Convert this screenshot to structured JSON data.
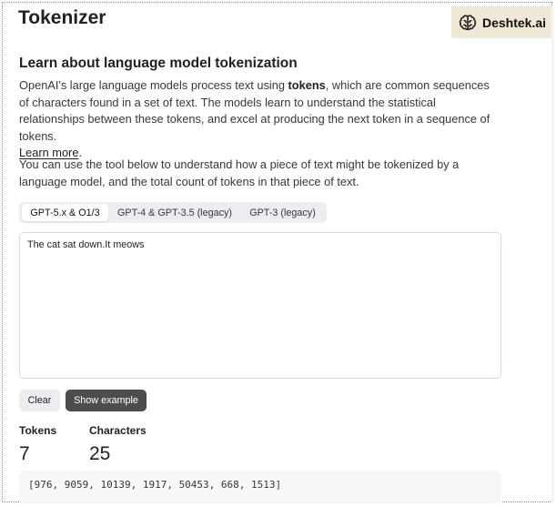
{
  "page": {
    "title": "Tokenizer"
  },
  "brand": {
    "icon": "brain-icon",
    "name": "Deshtek.ai",
    "background_color": "#f1e7d7"
  },
  "intro": {
    "heading": "Learn about language model tokenization",
    "p1_before": "OpenAI's large language models process text using ",
    "p1_bold": "tokens",
    "p1_after": ", which are common sequences of characters found in a set of text. The models learn to understand the statistical relationships between these tokens, and excel at producing the next token in a sequence of tokens.",
    "learn_more_label": "Learn more",
    "learn_more_suffix": ".",
    "p2": "You can use the tool below to understand how a piece of text might be tokenized by a language model, and the total count of tokens in that piece of text."
  },
  "tabs": [
    {
      "label": "GPT-5.x & O1/3",
      "active": true
    },
    {
      "label": "GPT-4 & GPT-3.5 (legacy)",
      "active": false
    },
    {
      "label": "GPT-3 (legacy)",
      "active": false
    }
  ],
  "editor": {
    "value": "The cat sat down.It meows"
  },
  "buttons": {
    "clear_label": "Clear",
    "example_label": "Show example",
    "example_color": "#4d4d4f"
  },
  "stats": {
    "tokens_label": "Tokens",
    "tokens_value": "7",
    "characters_label": "Characters",
    "characters_value": "25"
  },
  "token_ids": {
    "text": "[976, 9059, 10139, 1917, 50453, 668, 1513]"
  }
}
